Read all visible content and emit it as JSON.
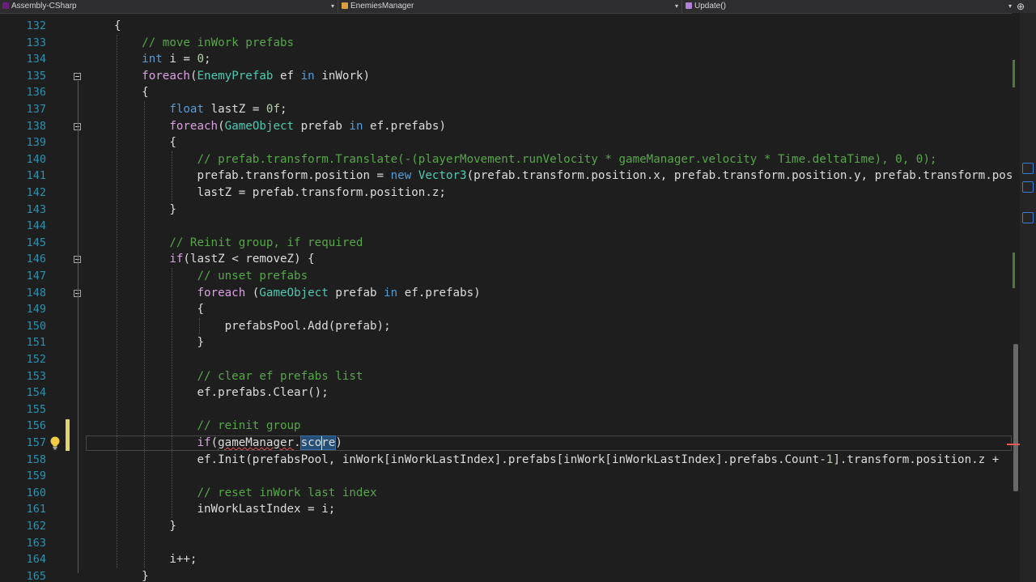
{
  "navbar": {
    "project": "Assembly-CSharp",
    "class": "EnemiesManager",
    "member": "Update()",
    "split_glyph": "⊕"
  },
  "colors": {
    "keyword": "#569cd6",
    "comment": "#57a64a",
    "type": "#4ec9b0",
    "number": "#b5cea8",
    "line_number": "#2b91af",
    "text": "#dcdcdc"
  },
  "editor": {
    "current_line": 157,
    "lines": [
      {
        "n": "132",
        "indent": 1,
        "tokens": [
          [
            "{",
            "p"
          ]
        ]
      },
      {
        "n": "133",
        "indent": 2,
        "tokens": [
          [
            "// move inWork prefabs",
            "cm"
          ]
        ]
      },
      {
        "n": "134",
        "indent": 2,
        "tokens": [
          [
            "int",
            "kw"
          ],
          [
            " i = ",
            "p"
          ],
          [
            "0",
            "nu"
          ],
          [
            ";",
            "p"
          ]
        ]
      },
      {
        "n": "135",
        "indent": 2,
        "fold": true,
        "tokens": [
          [
            "foreach",
            "ev"
          ],
          [
            "(",
            "p"
          ],
          [
            "EnemyPrefab",
            "ty"
          ],
          [
            " ef ",
            "p"
          ],
          [
            "in",
            "kw"
          ],
          [
            " inWork)",
            "p"
          ]
        ]
      },
      {
        "n": "136",
        "indent": 2,
        "tokens": [
          [
            "{",
            "p"
          ]
        ]
      },
      {
        "n": "137",
        "indent": 3,
        "tokens": [
          [
            "float",
            "kw"
          ],
          [
            " lastZ = ",
            "p"
          ],
          [
            "0f",
            "nu"
          ],
          [
            ";",
            "p"
          ]
        ]
      },
      {
        "n": "138",
        "indent": 3,
        "fold": true,
        "tokens": [
          [
            "foreach",
            "ev"
          ],
          [
            "(",
            "p"
          ],
          [
            "GameObject",
            "ty"
          ],
          [
            " prefab ",
            "p"
          ],
          [
            "in",
            "kw"
          ],
          [
            " ef.prefabs)",
            "p"
          ]
        ]
      },
      {
        "n": "139",
        "indent": 3,
        "tokens": [
          [
            "{",
            "p"
          ]
        ]
      },
      {
        "n": "140",
        "indent": 4,
        "tokens": [
          [
            "// prefab.transform.Translate(-(playerMovement.runVelocity * gameManager.velocity * Time.deltaTime), 0, 0);",
            "cm"
          ]
        ]
      },
      {
        "n": "141",
        "indent": 4,
        "tokens": [
          [
            "prefab.transform.position = ",
            "p"
          ],
          [
            "new",
            "kw"
          ],
          [
            " ",
            "p"
          ],
          [
            "Vector3",
            "ty"
          ],
          [
            "(prefab.transform.position.x, prefab.transform.position.y, prefab.transform.position.z",
            "p"
          ]
        ]
      },
      {
        "n": "142",
        "indent": 4,
        "tokens": [
          [
            "lastZ = prefab.transform.position.z;",
            "p"
          ]
        ]
      },
      {
        "n": "143",
        "indent": 3,
        "tokens": [
          [
            "}",
            "p"
          ]
        ]
      },
      {
        "n": "144",
        "indent": 0,
        "tokens": []
      },
      {
        "n": "145",
        "indent": 3,
        "tokens": [
          [
            "// Reinit group, if required",
            "cm"
          ]
        ]
      },
      {
        "n": "146",
        "indent": 3,
        "fold": true,
        "tokens": [
          [
            "if",
            "ev"
          ],
          [
            "(lastZ < removeZ) {",
            "p"
          ]
        ]
      },
      {
        "n": "147",
        "indent": 4,
        "tokens": [
          [
            "// unset prefabs",
            "cm"
          ]
        ]
      },
      {
        "n": "148",
        "indent": 4,
        "fold": true,
        "tokens": [
          [
            "foreach",
            "ev"
          ],
          [
            " (",
            "p"
          ],
          [
            "GameObject",
            "ty"
          ],
          [
            " prefab ",
            "p"
          ],
          [
            "in",
            "kw"
          ],
          [
            " ef.prefabs)",
            "p"
          ]
        ]
      },
      {
        "n": "149",
        "indent": 4,
        "tokens": [
          [
            "{",
            "p"
          ]
        ]
      },
      {
        "n": "150",
        "indent": 5,
        "tokens": [
          [
            "prefabsPool.Add(prefab);",
            "p"
          ]
        ]
      },
      {
        "n": "151",
        "indent": 4,
        "tokens": [
          [
            "}",
            "p"
          ]
        ]
      },
      {
        "n": "152",
        "indent": 0,
        "tokens": []
      },
      {
        "n": "153",
        "indent": 4,
        "tokens": [
          [
            "// clear ef prefabs list",
            "cm"
          ]
        ]
      },
      {
        "n": "154",
        "indent": 4,
        "tokens": [
          [
            "ef.prefabs.Clear();",
            "p"
          ]
        ]
      },
      {
        "n": "155",
        "indent": 0,
        "tokens": []
      },
      {
        "n": "156",
        "indent": 4,
        "tokens": [
          [
            "// reinit group",
            "cm"
          ]
        ]
      },
      {
        "n": "157",
        "indent": 4,
        "tokens": [
          [
            "if",
            "ev"
          ],
          [
            "(",
            "p"
          ],
          [
            "gameManager",
            "sq"
          ],
          [
            ".",
            "p"
          ],
          [
            "score",
            "sel"
          ],
          [
            ")",
            "p"
          ]
        ]
      },
      {
        "n": "158",
        "indent": 4,
        "tokens": [
          [
            "ef.Init(prefabsPool, inWork[inWorkLastIndex].prefabs[inWork[inWorkLastIndex].prefabs.Count-",
            "p"
          ],
          [
            "1",
            "nu"
          ],
          [
            "].transform.position.z + ",
            "p"
          ]
        ]
      },
      {
        "n": "159",
        "indent": 0,
        "tokens": []
      },
      {
        "n": "160",
        "indent": 4,
        "tokens": [
          [
            "// reset inWork last index",
            "cm"
          ]
        ]
      },
      {
        "n": "161",
        "indent": 4,
        "tokens": [
          [
            "inWorkLastIndex = i;",
            "p"
          ]
        ]
      },
      {
        "n": "162",
        "indent": 3,
        "tokens": [
          [
            "}",
            "p"
          ]
        ]
      },
      {
        "n": "163",
        "indent": 0,
        "tokens": []
      },
      {
        "n": "164",
        "indent": 3,
        "tokens": [
          [
            "i++;",
            "p"
          ]
        ]
      },
      {
        "n": "165",
        "indent": 2,
        "tokens": [
          [
            "}",
            "p"
          ]
        ]
      }
    ]
  }
}
